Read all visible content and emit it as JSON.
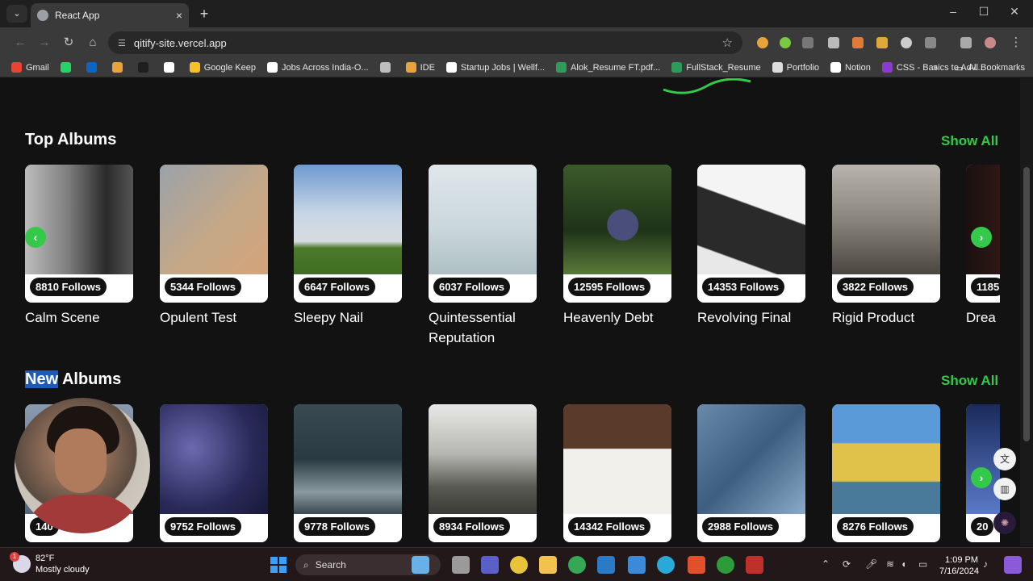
{
  "browser": {
    "tab_title": "React App",
    "tab_close": "×",
    "new_tab": "+",
    "tab_menu": "⌄",
    "url": "qitify-site.vercel.app",
    "win_min": "–",
    "win_max": "☐",
    "win_close": "✕"
  },
  "bookmarks": [
    {
      "label": "Gmail",
      "color": "#ea4335"
    },
    {
      "label": "",
      "color": "#25d366"
    },
    {
      "label": "",
      "color": "#0a66c2"
    },
    {
      "label": "",
      "color": "#e8a33a"
    },
    {
      "label": "",
      "color": "#1f1f1f"
    },
    {
      "label": "",
      "color": "#ffffff"
    },
    {
      "label": "Google Keep",
      "color": "#f6c026"
    },
    {
      "label": "Jobs Across India-O...",
      "color": "#ffffff"
    },
    {
      "label": "",
      "color": "#bdbdbd"
    },
    {
      "label": "IDE",
      "color": "#e8a33a"
    },
    {
      "label": "Startup Jobs | Wellf...",
      "color": "#ffffff"
    },
    {
      "label": "Alok_Resume FT.pdf...",
      "color": "#2e9b5a"
    },
    {
      "label": "FullStack_Resume",
      "color": "#2e9b5a"
    },
    {
      "label": "Portfolio",
      "color": "#dddddd"
    },
    {
      "label": "Notion",
      "color": "#ffffff"
    },
    {
      "label": "CSS - Basics to Adv...",
      "color": "#8a3ad0"
    }
  ],
  "bookmarks_more": "»",
  "all_bookmarks": "All Bookmarks",
  "top_albums": {
    "title": "Top Albums",
    "show_all": "Show All",
    "cards": [
      {
        "follows": "8810 Follows",
        "name": "Calm Scene",
        "bg": "linear-gradient(90deg,#bdbdbd,#7d7d7d 40%,#2a2a2a 75%,#555)"
      },
      {
        "follows": "5344 Follows",
        "name": "Opulent Test",
        "bg": "linear-gradient(135deg,#9aa2ab,#c4a887 55%,#d4a47a)"
      },
      {
        "follows": "6647 Follows",
        "name": "Sleepy Nail",
        "bg": "linear-gradient(180deg,#6e9ad0 0%,#c9d6e6 45%,#d7dbe0 70%,#4a7a2a 76%,#3f6d22 100%)"
      },
      {
        "follows": "6037 Follows",
        "name": "Quintessential Reputation",
        "bg": "linear-gradient(180deg,#dfe7ea,#c9d6da 60%,#aebfc4)"
      },
      {
        "follows": "12595 Follows",
        "name": "Heavenly Debt",
        "bg": "radial-gradient(circle at 55% 55%,#4a4e7a 0 18%,transparent 19%),linear-gradient(180deg,#3b5a2a,#1f3318 60%,#5a7a3a)"
      },
      {
        "follows": "14353 Follows",
        "name": "Revolving Final",
        "bg": "linear-gradient(200deg,#f4f4f4 0 40%,#2a2a2a 41% 80%,#e8e8e8 81%)"
      },
      {
        "follows": "3822 Follows",
        "name": "Rigid Product",
        "bg": "linear-gradient(180deg,#b8b4ad,#8a857c 50%,#4a4640)"
      },
      {
        "follows": "1185",
        "name": "Drea",
        "bg": "linear-gradient(90deg,#1a1010,#5a2a20)"
      }
    ]
  },
  "new_albums": {
    "title_highlight": "New",
    "title_rest": " Albums",
    "show_all": "Show All",
    "cards": [
      {
        "follows": "140",
        "name": "",
        "bg": "linear-gradient(180deg,#8a9ab0,#55657a)"
      },
      {
        "follows": "9752 Follows",
        "name": "",
        "bg": "radial-gradient(circle at 30% 40%,#6a6ab0,#2a2a5a 60%,#181838)"
      },
      {
        "follows": "9778 Follows",
        "name": "",
        "bg": "linear-gradient(180deg,#3a4a52,#2a3a42 50%,#8a9aa0 80%,#3a4a50)"
      },
      {
        "follows": "8934 Follows",
        "name": "",
        "bg": "linear-gradient(180deg,#e8e8e6,#b6b6b2 45%,#5a5a54 75%,#3a3a36)"
      },
      {
        "follows": "14342 Follows",
        "name": "",
        "bg": "linear-gradient(180deg,#5a3a2a 0 40%,#f2f0ea 41%)"
      },
      {
        "follows": "2988 Follows",
        "name": "",
        "bg": "linear-gradient(135deg,#6a8aaa,#3e5e80 50%,#8aaac8)"
      },
      {
        "follows": "8276 Follows",
        "name": "",
        "bg": "linear-gradient(180deg,#5a9ad8 0 35%,#e0c24a 36% 70%,#4a7a9a 71%)"
      },
      {
        "follows": "20",
        "name": "",
        "bg": "linear-gradient(180deg,#1a2a5a,#5a7ac8)"
      }
    ]
  },
  "arrows": {
    "prev": "‹",
    "next": "›"
  },
  "taskbar": {
    "temp": "82°F",
    "condition": "Mostly cloudy",
    "badge": "1",
    "search": "Search",
    "time": "1:09 PM",
    "date": "7/16/2024"
  }
}
